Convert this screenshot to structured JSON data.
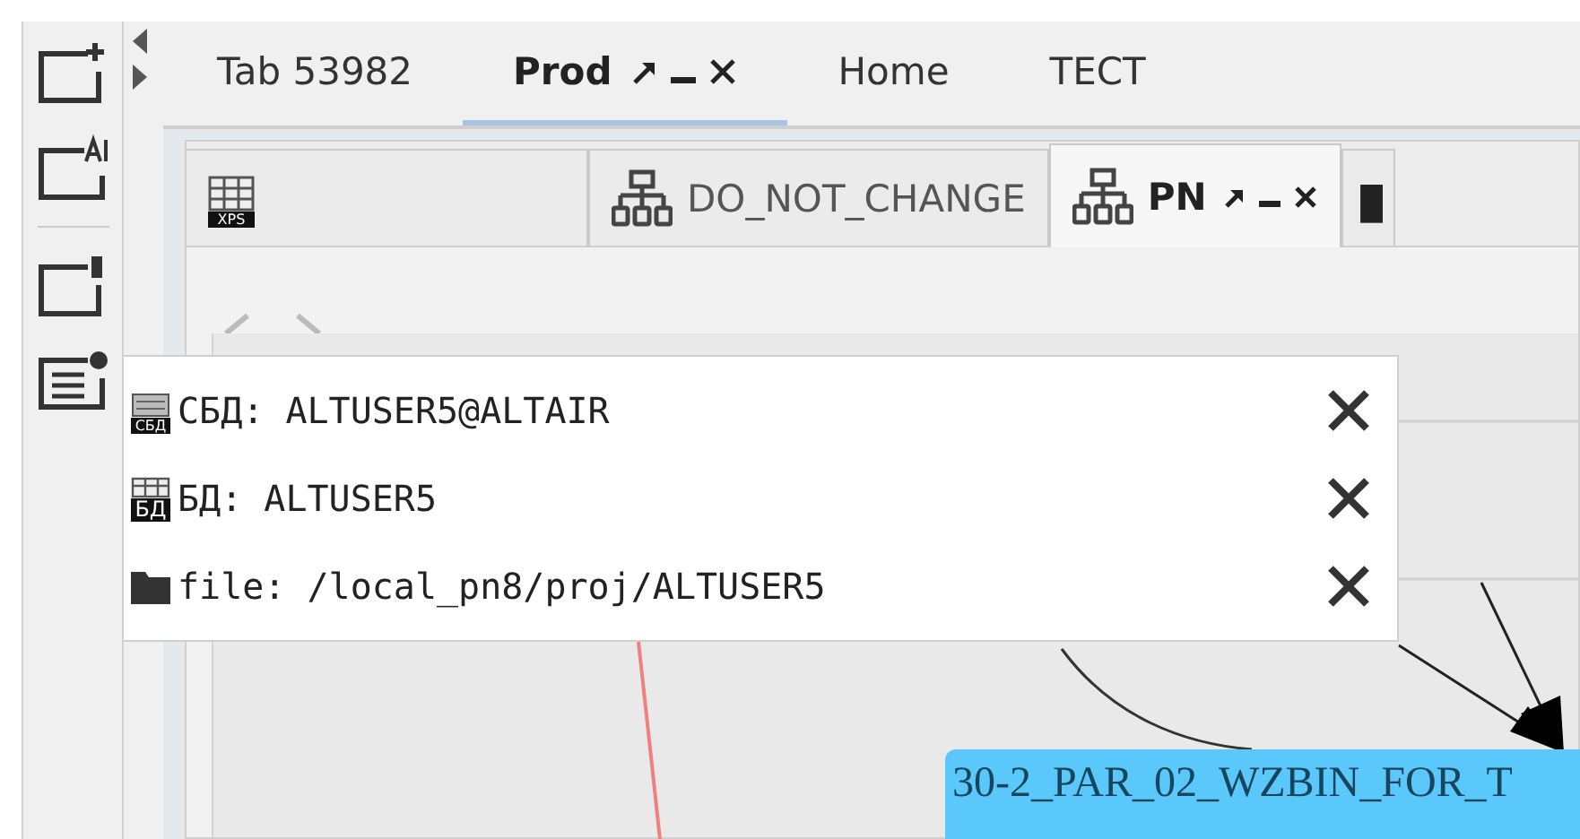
{
  "tabs": [
    {
      "label": "Tab 53982",
      "selected": false,
      "closable": false
    },
    {
      "label": "Prod",
      "selected": true,
      "closable": true
    },
    {
      "label": "Home",
      "selected": false,
      "closable": false
    },
    {
      "label": "TECT",
      "selected": false,
      "closable": false
    }
  ],
  "inner_tabs": [
    {
      "kind": "table",
      "badge": "XPS",
      "selected": false,
      "closable": false
    },
    {
      "kind": "hierarchy",
      "label": "DO_NOT_CHANGE",
      "selected": false,
      "closable": false
    },
    {
      "kind": "hierarchy",
      "label": "PN",
      "selected": true,
      "closable": true
    },
    {
      "kind": "dark",
      "selected": false,
      "closable": false
    }
  ],
  "popup": {
    "items": [
      {
        "kind": "server",
        "badge": "СБД",
        "label": "СБД: ALTUSER5@ALTAIR"
      },
      {
        "kind": "database",
        "badge": "БД",
        "label": "БД: ALTUSER5"
      },
      {
        "kind": "folder",
        "label": "file: /local_pn8/proj/ALTUSER5"
      }
    ]
  },
  "graph": {
    "nodes": [
      {
        "label": "30-2_PAR_02_WZBIN_FOR_T"
      }
    ]
  }
}
